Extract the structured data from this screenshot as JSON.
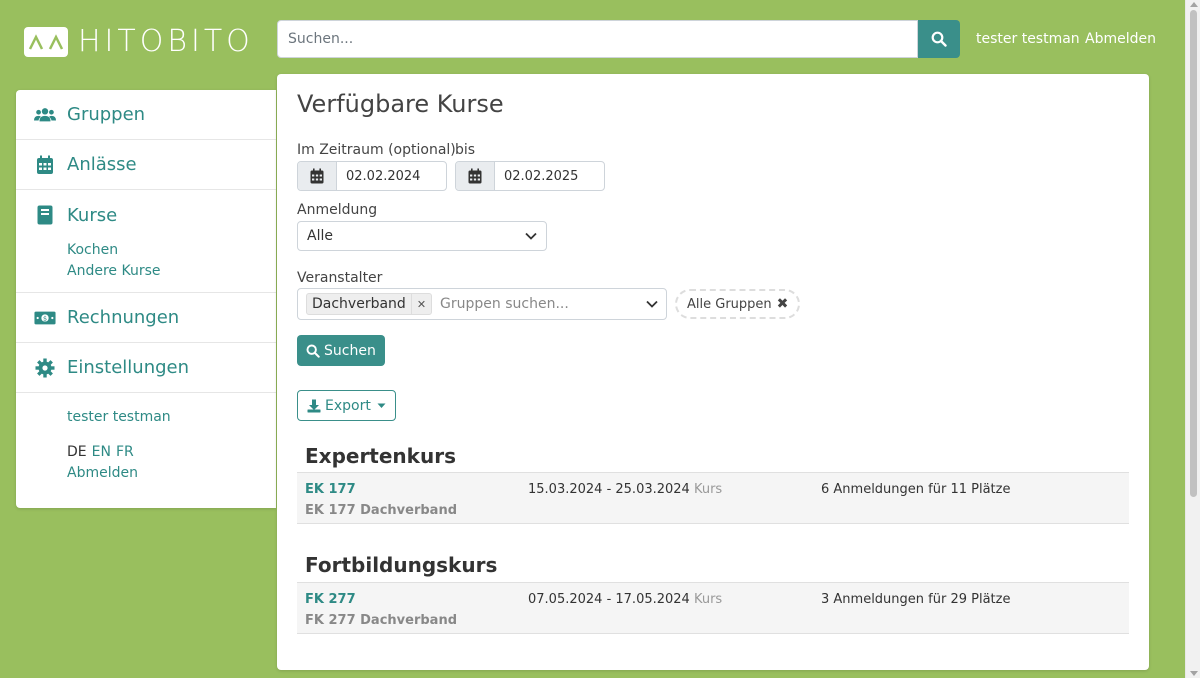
{
  "header": {
    "logo_text": "HITOBITO",
    "search_placeholder": "Suchen...",
    "user_name": "tester testman",
    "logout": "Abmelden"
  },
  "sidebar": {
    "items": [
      {
        "label": "Gruppen",
        "icon": "users-icon"
      },
      {
        "label": "Anlässe",
        "icon": "calendar-icon"
      },
      {
        "label": "Kurse",
        "icon": "book-icon"
      },
      {
        "label": "Rechnungen",
        "icon": "money-bill-icon"
      },
      {
        "label": "Einstellungen",
        "icon": "cog-icon"
      }
    ],
    "kurse_sub": [
      "Kochen",
      "Andere Kurse"
    ],
    "user_name": "tester testman",
    "lang_current": "DE",
    "lang_en": "EN",
    "lang_fr": "FR",
    "logout": "Abmelden"
  },
  "main": {
    "title": "Verfügbare Kurse",
    "period_label": "Im Zeitraum (optional)",
    "until_label": "bis",
    "date_from": "02.02.2024",
    "date_to": "02.02.2025",
    "registration_label": "Anmeldung",
    "registration_value": "Alle",
    "organizer_label": "Veranstalter",
    "organizer_tag": "Dachverband",
    "organizer_placeholder": "Gruppen suchen...",
    "all_groups": "Alle Gruppen",
    "search_button": "Suchen",
    "export_button": "Export",
    "sections": [
      {
        "title": "Expertenkurs",
        "course": {
          "code": "EK 177",
          "subtitle": "EK 177 Dachverband",
          "dates": "15.03.2024 - 25.03.2024",
          "kind": "Kurs",
          "registrations": "6 Anmeldungen für 11 Plätze"
        }
      },
      {
        "title": "Fortbildungskurs",
        "course": {
          "code": "FK 277",
          "subtitle": "FK 277 Dachverband",
          "dates": "07.05.2024 - 17.05.2024",
          "kind": "Kurs",
          "registrations": "3 Anmeldungen für 29 Plätze"
        }
      }
    ]
  },
  "colors": {
    "background": "#99bf5e",
    "accent": "#3a8f8a",
    "link": "#2e8a85"
  }
}
